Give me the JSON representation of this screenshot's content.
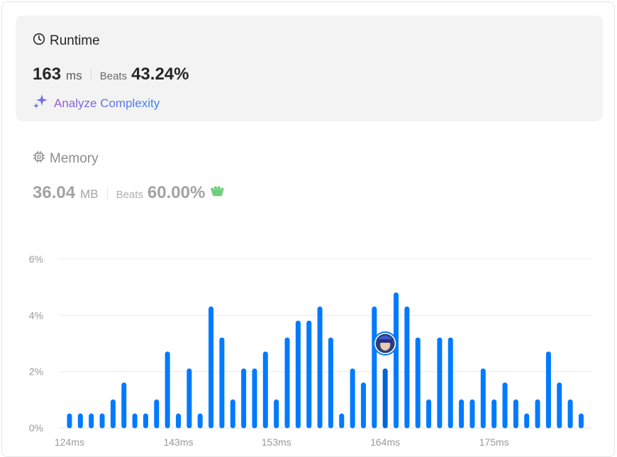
{
  "runtime": {
    "title": "Runtime",
    "value": "163",
    "unit": "ms",
    "beats_label": "Beats",
    "beats_value": "43.24%",
    "analyze_label": "Analyze Complexity"
  },
  "memory": {
    "title": "Memory",
    "value": "36.04",
    "unit": "MB",
    "beats_label": "Beats",
    "beats_value": "60.00%"
  },
  "colors": {
    "bar": "#007aff",
    "highlight_bar": "#0066d6",
    "runtime_card_bg": "#f3f3f3",
    "analyze_gradient_start": "#9b59d6",
    "analyze_gradient_end": "#3b82f6",
    "wave_icon": "#5cc96b"
  },
  "icons": {
    "runtime": "clock-icon",
    "memory": "chip-icon",
    "analyze": "sparkle-icon",
    "memory_badge": "clapping-hands-icon",
    "marker": "user-avatar"
  },
  "chart_data": {
    "type": "bar",
    "y_unit": "%",
    "ylim": [
      0,
      6
    ],
    "y_ticks": [
      "0%",
      "2%",
      "4%",
      "6%"
    ],
    "x_tick_labels": [
      "124ms",
      "143ms",
      "153ms",
      "164ms",
      "175ms"
    ],
    "grid": true,
    "values": [
      0.5,
      0.5,
      0.5,
      0.5,
      1.0,
      1.6,
      0.5,
      0.5,
      1.0,
      2.7,
      0.5,
      2.1,
      0.5,
      4.3,
      3.2,
      1.0,
      2.1,
      2.1,
      2.7,
      1.0,
      3.2,
      3.8,
      3.8,
      4.3,
      3.2,
      0.5,
      2.1,
      1.6,
      4.3,
      2.1,
      4.8,
      4.3,
      3.2,
      1.0,
      3.2,
      3.2,
      1.0,
      1.0,
      2.1,
      1.0,
      1.6,
      1.0,
      0.5,
      1.0,
      2.7,
      1.6,
      1.0,
      0.5
    ],
    "x_tick_indices": [
      0,
      10,
      19,
      29,
      39
    ],
    "highlight_index": 29,
    "marker_value": 3.0
  }
}
